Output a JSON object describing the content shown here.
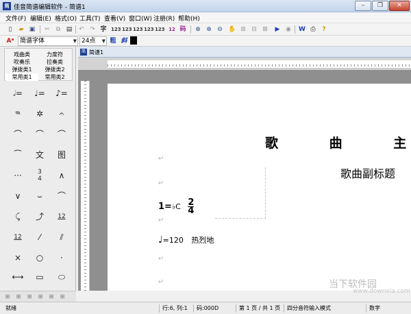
{
  "window": {
    "title": "佳音简谱编辑软件 - 简谱1",
    "app_icon_text": "简",
    "min": "–",
    "max": "❐",
    "close": "✕"
  },
  "menu": [
    "文件(F)",
    "编辑(E)",
    "格式(O)",
    "工具(T)",
    "查看(V)",
    "窗口(W)",
    "注册(R)",
    "帮助(H)"
  ],
  "toolbar": {
    "char_button": "字",
    "code_button": "码"
  },
  "format_bar": {
    "font_name": "简谱字体",
    "font_size": "24点",
    "bold": "粗",
    "italic": "斜"
  },
  "categories": [
    [
      "戏曲类",
      "力度符"
    ],
    [
      "吹奏乐",
      "拉奏类"
    ],
    [
      "弹拨类1",
      "弹拨类2"
    ],
    [
      "常用类1",
      "常用类2"
    ]
  ],
  "palette_labels": {
    "text_tool": "文",
    "pic_tool": "图",
    "time_sig_top": "3",
    "time_sig_bottom": "4",
    "twelve": "12"
  },
  "doc_tab": "简谱1",
  "score": {
    "title": "歌 曲 主",
    "subtitle": "歌曲副标题",
    "key_prefix": "1=",
    "key": "♭C",
    "time_top": "2",
    "time_bottom": "4",
    "tempo_prefix": "=120",
    "tempo_text": "热烈地"
  },
  "watermark": {
    "main": "当下软件园",
    "sub": "www.downxia.com"
  },
  "status": {
    "ready": "就绪",
    "position": "行:6, 列:1",
    "code": "码:000D",
    "page": "第 1 页 / 共 1 页",
    "mode": "四分音符输入模式",
    "num": "数字"
  }
}
